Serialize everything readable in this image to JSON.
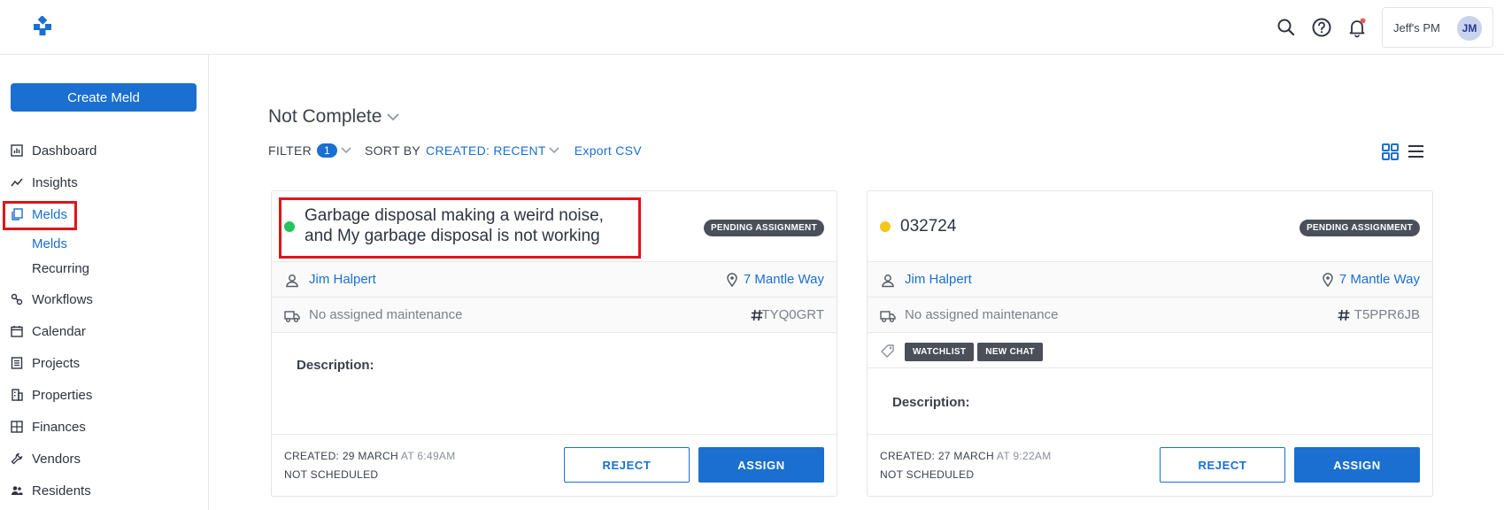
{
  "header": {
    "user_name": "Jeff's PM",
    "avatar_initials": "JM",
    "notification_dot_color": "#e35d5d"
  },
  "sidebar": {
    "create_label": "Create Meld",
    "items": [
      {
        "label": "Dashboard",
        "icon": "dashboard-icon"
      },
      {
        "label": "Insights",
        "icon": "insights-icon"
      },
      {
        "label": "Melds",
        "icon": "melds-icon",
        "active": true
      },
      {
        "label": "Workflows",
        "icon": "workflows-icon"
      },
      {
        "label": "Calendar",
        "icon": "calendar-icon"
      },
      {
        "label": "Projects",
        "icon": "projects-icon"
      },
      {
        "label": "Properties",
        "icon": "properties-icon"
      },
      {
        "label": "Finances",
        "icon": "finances-icon"
      },
      {
        "label": "Vendors",
        "icon": "vendors-icon"
      },
      {
        "label": "Residents",
        "icon": "residents-icon"
      }
    ],
    "sub_items": [
      {
        "label": "Melds",
        "active": true
      },
      {
        "label": "Recurring"
      }
    ]
  },
  "main": {
    "view_title": "Not Complete",
    "filter_label": "FILTER",
    "filter_count": "1",
    "sort_label": "SORT BY",
    "sort_value": "CREATED: RECENT",
    "export_label": "Export CSV"
  },
  "cards": [
    {
      "status_color": "#22c55e",
      "title_line1": "Garbage disposal making a weird noise,",
      "title_line2": "and My garbage disposal is not working",
      "status": "PENDING ASSIGNMENT",
      "tenant": "Jim Halpert",
      "address": "7 Mantle Way",
      "maintenance": "No assigned maintenance",
      "ref": "TYQ0GRT",
      "tags": [],
      "description_label": "Description:",
      "created_label": "CREATED:",
      "created_date": "29 MARCH",
      "created_time": "AT 6:49AM",
      "schedule": "NOT SCHEDULED",
      "reject_label": "REJECT",
      "assign_label": "ASSIGN"
    },
    {
      "status_color": "#f5c518",
      "title_line1": "032724",
      "title_line2": "",
      "status": "PENDING ASSIGNMENT",
      "tenant": "Jim Halpert",
      "address": "7 Mantle Way",
      "maintenance": "No assigned maintenance",
      "ref": "T5PPR6JB",
      "tags": [
        "WATCHLIST",
        "NEW CHAT"
      ],
      "description_label": "Description:",
      "created_label": "CREATED:",
      "created_date": "27 MARCH",
      "created_time": "AT 9:22AM",
      "schedule": "NOT SCHEDULED",
      "reject_label": "REJECT",
      "assign_label": "ASSIGN"
    }
  ],
  "colors": {
    "accent": "#1a6fd0",
    "highlight": "#e0141a"
  }
}
